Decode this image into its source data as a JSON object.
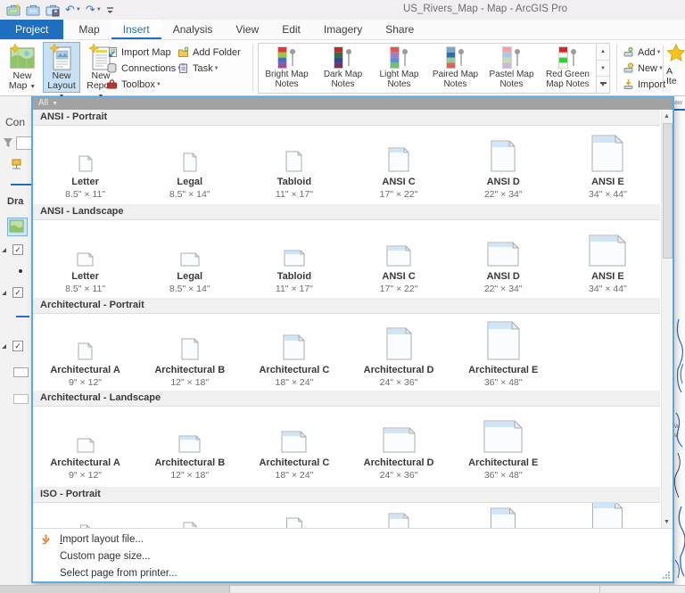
{
  "window": {
    "title": "US_Rivers_Map - Map - ArcGIS Pro"
  },
  "qat": [
    {
      "icon": "new-project-icon"
    },
    {
      "icon": "open-project-icon"
    },
    {
      "icon": "save-project-icon"
    },
    {
      "icon": "undo-icon",
      "dropdown": true
    },
    {
      "icon": "redo-icon",
      "dropdown": true
    },
    {
      "icon": "customize-quick-access-icon"
    }
  ],
  "tabs": [
    {
      "label": "Project",
      "style": "backstage"
    },
    {
      "label": "Map"
    },
    {
      "label": "Insert",
      "active": true
    },
    {
      "label": "Analysis"
    },
    {
      "label": "View"
    },
    {
      "label": "Edit"
    },
    {
      "label": "Imagery"
    },
    {
      "label": "Share"
    }
  ],
  "ribbon": {
    "new_group": [
      {
        "label": "New Map",
        "icon": "new-map-icon",
        "dropdown": true
      },
      {
        "label": "New Layout",
        "icon": "new-layout-icon",
        "dropdown": true,
        "pressed": true
      },
      {
        "label": "New Report",
        "icon": "new-report-icon",
        "dropdown": true
      }
    ],
    "project_buttons_col1": [
      {
        "label": "Import Map",
        "icon": "import-map-icon"
      },
      {
        "label": "Connections",
        "icon": "connections-icon",
        "dropdown": true
      },
      {
        "label": "Toolbox",
        "icon": "toolbox-icon",
        "dropdown": true
      }
    ],
    "project_buttons_col2": [
      {
        "label": "Add Folder",
        "icon": "add-folder-icon"
      },
      {
        "label": "Task",
        "icon": "task-icon",
        "dropdown": true
      }
    ],
    "map_notes_gallery": [
      {
        "label": "Bright Map Notes",
        "colors": [
          "#e23b2e",
          "#9ac93e",
          "#3e6fd1",
          "#9c4f9e"
        ]
      },
      {
        "label": "Dark Map Notes",
        "colors": [
          "#c42b20",
          "#2e7040",
          "#2c4a9e",
          "#7c3060"
        ]
      },
      {
        "label": "Light Map Notes",
        "colors": [
          "#e2574d",
          "#9d7ec9",
          "#5f8fdb",
          "#72c069"
        ]
      },
      {
        "label": "Paired Map Notes",
        "colors": [
          "#6fa8dc",
          "#2d6cb5",
          "#93cf8a",
          "#e06055"
        ]
      },
      {
        "label": "Pastel Map Notes",
        "colors": [
          "#efa3a8",
          "#a9c7e8",
          "#c4e0a8",
          "#cbb7de"
        ]
      },
      {
        "label": "Red Green Map Notes",
        "colors": [
          "#e02020",
          "#f2f2f2",
          "#2ed32e",
          "#f2f2f2"
        ]
      }
    ],
    "favorites_buttons": [
      {
        "label": "Add",
        "icon": "add-item-icon",
        "dropdown": true
      },
      {
        "label": "New",
        "icon": "new-item-icon",
        "dropdown": true
      },
      {
        "label": "Import",
        "icon": "import-item-icon"
      }
    ],
    "star_button": {
      "icon": "favorite-star-icon",
      "lines": [
        "A",
        "Ite"
      ]
    }
  },
  "dropdown": {
    "filter_label": "All",
    "sections": [
      {
        "header": "ANSI - Portrait",
        "items": [
          {
            "label": "Letter",
            "size": "8.5\" × 11\"",
            "icon_w_in": 8.5,
            "icon_h_in": 11
          },
          {
            "label": "Legal",
            "size": "8.5\" × 14\"",
            "icon_w_in": 8.5,
            "icon_h_in": 14
          },
          {
            "label": "Tabloid",
            "size": "11\" × 17\"",
            "icon_w_in": 11,
            "icon_h_in": 17
          },
          {
            "label": "ANSI C",
            "size": "17\" × 22\"",
            "icon_w_in": 17,
            "icon_h_in": 22
          },
          {
            "label": "ANSI D",
            "size": "22\" × 34\"",
            "icon_w_in": 22,
            "icon_h_in": 34
          },
          {
            "label": "ANSI E",
            "size": "34\" × 44\"",
            "icon_w_in": 34,
            "icon_h_in": 44
          }
        ]
      },
      {
        "header": "ANSI - Landscape",
        "items": [
          {
            "label": "Letter",
            "size": "8.5\" × 11\"",
            "icon_w_in": 11,
            "icon_h_in": 8.5
          },
          {
            "label": "Legal",
            "size": "8.5\" × 14\"",
            "icon_w_in": 14,
            "icon_h_in": 8.5
          },
          {
            "label": "Tabloid",
            "size": "11\" × 17\"",
            "icon_w_in": 17,
            "icon_h_in": 11
          },
          {
            "label": "ANSI C",
            "size": "17\" × 22\"",
            "icon_w_in": 22,
            "icon_h_in": 17
          },
          {
            "label": "ANSI D",
            "size": "22\" × 34\"",
            "icon_w_in": 34,
            "icon_h_in": 22
          },
          {
            "label": "ANSI E",
            "size": "34\" × 44\"",
            "icon_w_in": 44,
            "icon_h_in": 34
          }
        ]
      },
      {
        "header": "Architectural - Portrait",
        "items": [
          {
            "label": "Architectural A",
            "size": "9\" × 12\"",
            "icon_w_in": 9,
            "icon_h_in": 12
          },
          {
            "label": "Architectural B",
            "size": "12\" × 18\"",
            "icon_w_in": 12,
            "icon_h_in": 18
          },
          {
            "label": "Architectural C",
            "size": "18\" × 24\"",
            "icon_w_in": 18,
            "icon_h_in": 24
          },
          {
            "label": "Architectural D",
            "size": "24\" × 36\"",
            "icon_w_in": 24,
            "icon_h_in": 36
          },
          {
            "label": "Architectural E",
            "size": "36\" × 48\"",
            "icon_w_in": 36,
            "icon_h_in": 48
          }
        ]
      },
      {
        "header": "Architectural - Landscape",
        "items": [
          {
            "label": "Architectural A",
            "size": "9\" × 12\"",
            "icon_w_in": 12,
            "icon_h_in": 9
          },
          {
            "label": "Architectural B",
            "size": "12\" × 18\"",
            "icon_w_in": 18,
            "icon_h_in": 12
          },
          {
            "label": "Architectural C",
            "size": "18\" × 24\"",
            "icon_w_in": 24,
            "icon_h_in": 18
          },
          {
            "label": "Architectural D",
            "size": "24\" × 36\"",
            "icon_w_in": 36,
            "icon_h_in": 24
          },
          {
            "label": "Architectural E",
            "size": "36\" × 48\"",
            "icon_w_in": 48,
            "icon_h_in": 36
          }
        ]
      },
      {
        "header": "ISO - Portrait",
        "partial": true,
        "items": [
          {
            "icon_w_in": 5.8,
            "icon_h_in": 8.3
          },
          {
            "icon_w_in": 8.3,
            "icon_h_in": 11.7
          },
          {
            "icon_w_in": 11.7,
            "icon_h_in": 16.5
          },
          {
            "icon_w_in": 16.5,
            "icon_h_in": 23.4
          },
          {
            "icon_w_in": 23.4,
            "icon_h_in": 33.1
          },
          {
            "icon_w_in": 33.1,
            "icon_h_in": 46.8
          }
        ]
      }
    ],
    "menu_items": [
      {
        "label": "Import layout file...",
        "icon": "import-layout-icon",
        "accel_first_letter": true
      },
      {
        "label": "Custom page size..."
      },
      {
        "label": "Select page from printer..."
      }
    ]
  },
  "contents_pane": {
    "title_clipped": "Con",
    "drawing_clipped": "Dra"
  },
  "colors": {
    "accent_blue": "#1e6fc0",
    "dropdown_border": "#5ea8dd",
    "pressed_bg": "#c8e0f4",
    "menu_arrow_orange": "#e8872c"
  }
}
